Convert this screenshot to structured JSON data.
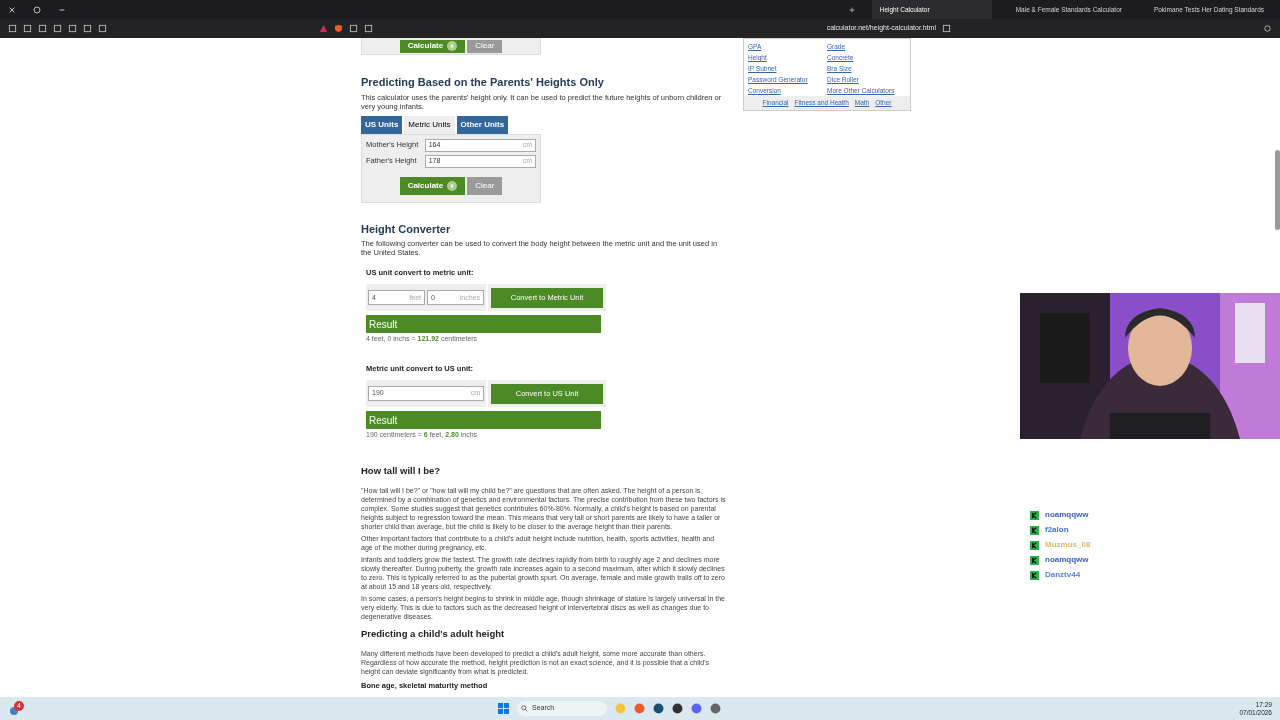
{
  "browser": {
    "tabs": [
      {
        "title": "Height Calculator",
        "selected": true
      },
      {
        "title": "Male & Female Standards Calculator",
        "selected": false
      },
      {
        "title": "Pokimane Tests Her Dating Standards",
        "selected": false
      }
    ],
    "url": "calculator.net/height-calculator.html"
  },
  "top_form": {
    "buttons": [
      {
        "label": "Calculate",
        "kind": "primary"
      },
      {
        "label": "Clear",
        "kind": "secondary"
      }
    ]
  },
  "sidebar": {
    "links": [
      "GPA",
      "Grade",
      "Height",
      "Concrete",
      "IP Subnet",
      "Bra Size",
      "Password Generator",
      "Dice Roller",
      "Conversion",
      "More Other Calculators"
    ],
    "categories": [
      "Financial",
      "Fitness and Health",
      "Math",
      "Other"
    ]
  },
  "parents_section": {
    "title": "Predicting Based on the Parents' Heights Only",
    "description": "This calculator uses the parents' height only. It can be used to predict the future heights of unborn children or very young infants.",
    "unit_tabs": [
      {
        "label": "US Units",
        "selected": false
      },
      {
        "label": "Metric Units",
        "selected": true
      },
      {
        "label": "Other Units",
        "selected": false
      }
    ],
    "fields": [
      {
        "label": "Mother's Height",
        "value": "164",
        "unit": "cm"
      },
      {
        "label": "Father's Height",
        "value": "178",
        "unit": "cm"
      }
    ],
    "buttons": [
      {
        "label": "Calculate",
        "kind": "primary"
      },
      {
        "label": "Clear",
        "kind": "secondary"
      }
    ]
  },
  "converter": {
    "title": "Height Converter",
    "description": "The following converter can be used to convert the body height between the metric unit and the unit used in the United States.",
    "blocks": [
      {
        "label": "US unit convert to metric unit:",
        "fields": [
          {
            "value": "4",
            "unit": "feet"
          },
          {
            "value": "0",
            "unit": "inches"
          }
        ],
        "button": "Convert to Metric Unit",
        "result_title": "Result",
        "result": "4 feet, 0 inchs = **121.92** centimeters"
      },
      {
        "label": "Metric unit convert to US unit:",
        "fields": [
          {
            "value": "190",
            "unit": "cm"
          }
        ],
        "button": "Convert to US Unit",
        "result_title": "Result",
        "result": "190 centimeters = **6** feet, **2.80** inchs"
      }
    ]
  },
  "article": [
    {
      "kind": "heading",
      "text": "How tall will I be?"
    },
    {
      "kind": "paragraph",
      "text": "\"How tall will I be?\" or \"how tall will my child be?\" are questions that are often asked. The height of a person is determined by a combination of genetics and environmental factors. The precise contribution from these two factors is complex. Some studies suggest that genetics contributes 60%-80%. Normally, a child's height is based on parental heights subject to regression toward the mean. This means that very tall or short parents are likely to have a taller or shorter child than average, but the child is likely to be closer to the average height than their parents."
    },
    {
      "kind": "paragraph",
      "text": "Other important factors that contribute to a child's adult height include nutrition, health, sports activities, health and age of the mother during pregnancy, etc."
    },
    {
      "kind": "paragraph",
      "text": "Infants and toddlers grow the fastest. The growth rate declines rapidly from birth to roughly age 2 and declines more slowly thereafter. During puberty, the growth rate increases again to a second maximum, after which it slowly declines to zero. This is typically referred to as the pubertal growth spurt. On average, female and male growth trails off to zero at about 15 and 18 years old, respectively."
    },
    {
      "kind": "paragraph",
      "text": "In some cases, a person's height begins to shrink in middle age, though shrinkage of stature is largely universal in the very elderly. This is due to factors such as the decreased height of intervertebral discs as well as changes due to degenerative diseases."
    },
    {
      "kind": "heading",
      "text": "Predicting a child's adult height"
    },
    {
      "kind": "paragraph",
      "text": "Many different methods have been developed to predict a child's adult height, some more accurate than others. Regardless of how accurate the method, height prediction is not an exact science, and it is possible that a child's height can deviate significantly from what is predicted."
    },
    {
      "kind": "subheading",
      "text": "Bone age, skeletal maturity method"
    }
  ],
  "chat": [
    {
      "user": "noamqqww",
      "color": "#3b5fc0"
    },
    {
      "user": "f2alon",
      "color": "#3b73d6"
    },
    {
      "user": "Muzmus_08",
      "color": "#e0b868"
    },
    {
      "user": "noamqqww",
      "color": "#3b5fc0"
    },
    {
      "user": "Danztv44",
      "color": "#5a7fd0"
    }
  ],
  "taskbar": {
    "notifications": "4",
    "search": "Search",
    "time": "17:29",
    "date": "07/01/2026"
  }
}
